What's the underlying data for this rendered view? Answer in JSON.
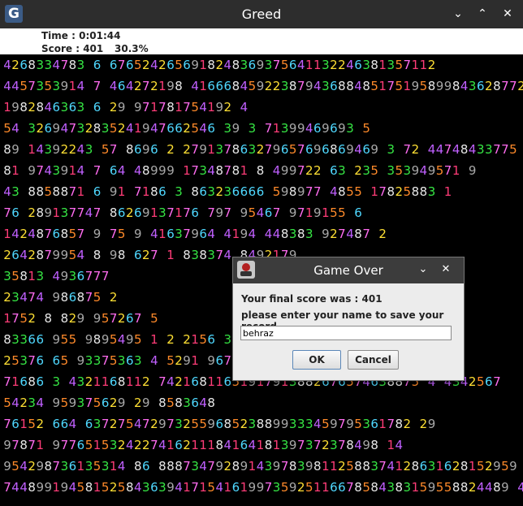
{
  "window": {
    "title": "Greed",
    "icon": "G"
  },
  "status": {
    "time": "Time : 0:01:44",
    "score": "Score : 401",
    "percent": "30.3%"
  },
  "board": {
    "rows": [
      "4268334783 6 6765242656918248369375641132246381357112",
      "4457353914 7 464272198 41666845922387943688485175195899843628772",
      "1982846363 6 29 971781754192 4",
      "54 32694732835241947662546 39 3 71399469693 5",
      "89 14392243 57 8696 2 279137863279657696869469 3 72 44748433775 5",
      "81 9743914 7 64 48999 17348781 8 499722 63 235 353949571 9",
      "43 8858871 6 91 7186 3 863236666 598977 4855 17825883 1",
      "76 289137747 86269137176 797 95467 9719155 6",
      "1424876857 9 75 9 41637964 4194 448383 927487 2",
      "2642879954 8 98 627 1 838374 8492179",
      "35813 4936777",
      "23474 986875 2",
      "1752 8 829 957267 5",
      "83366 955 9895495 1 2 2156 367369 5",
      "25376 65 93375363 4 5291 96784 21",
      "71686 3 4321168112 74216811651917913882676574638875 4 4342567",
      "54234 959375629 29 8583648",
      "76152 664 6372754729732559685238899333459795361782 29",
      "97871 9776515324227416211184164181397372378498 14",
      "954298736135314 86 88873479289143978398112588374128631628152959 5",
      "74489919458152584363941715416199735925116678584383159558824489 4"
    ],
    "colors": [
      "#3f9cff",
      "#ff3c78",
      "#ffe034",
      "#36e644",
      "#c060ff",
      "#ff8a2a",
      "#4fd8ff",
      "#ff6cf0",
      "#e8e8e8",
      "#a8a8a8"
    ]
  },
  "dialog": {
    "title": "Game Over",
    "message": "Your final score was : 401",
    "prompt": "please enter your name to save your record",
    "name_value": "behraz",
    "ok_label": "OK",
    "cancel_label": "Cancel"
  }
}
